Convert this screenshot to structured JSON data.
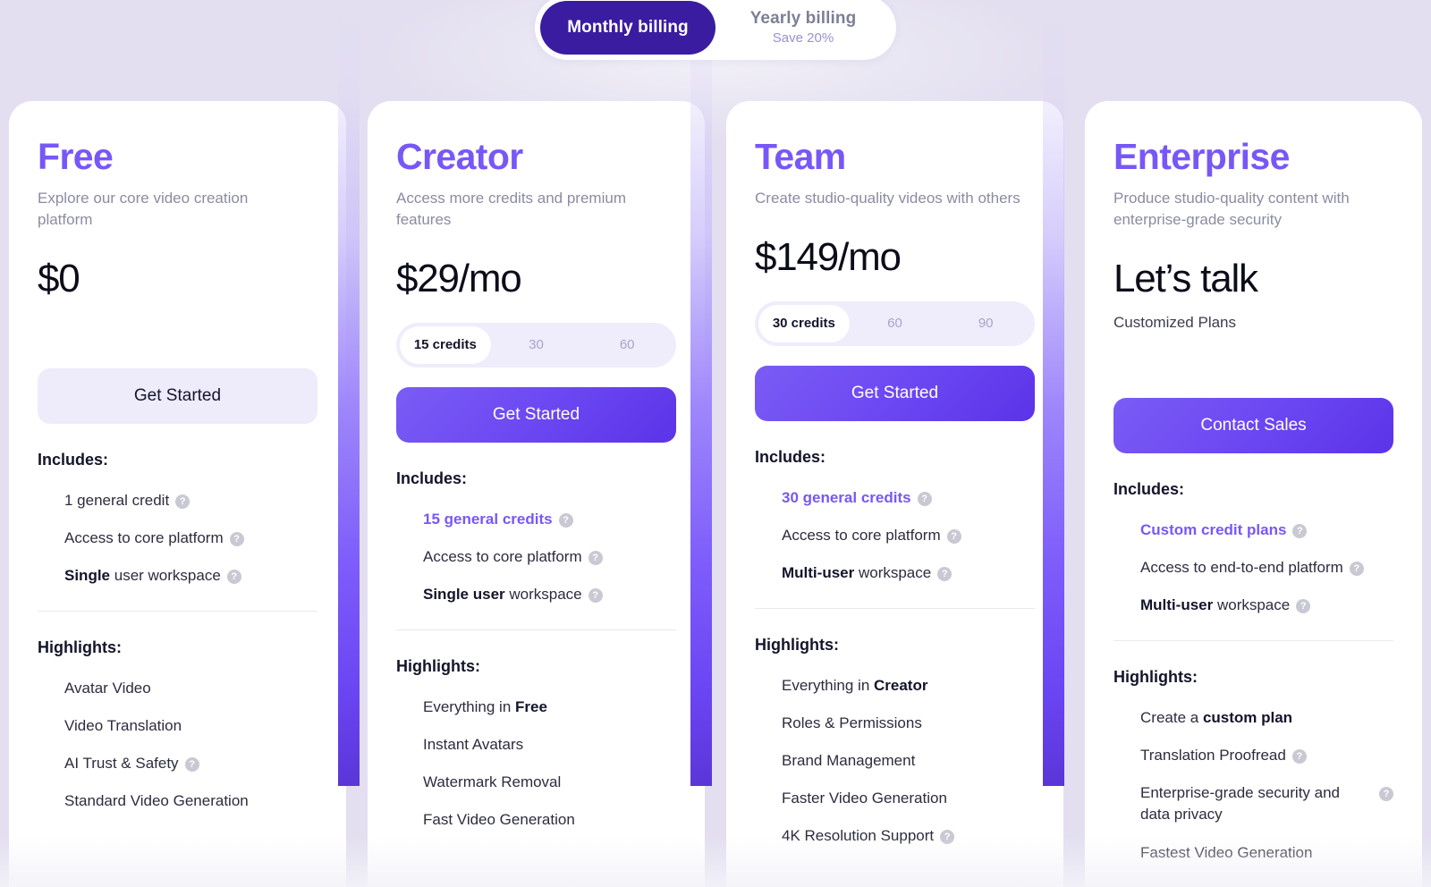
{
  "billing": {
    "monthly_label": "Monthly billing",
    "yearly_label": "Yearly billing",
    "yearly_sub": "Save 20%",
    "active": "monthly"
  },
  "colors": {
    "accent": "#7857f7",
    "accent_dark": "#3a1ca0",
    "background": "#e3dff0",
    "card": "#ffffff"
  },
  "labels": {
    "includes": "Includes:",
    "highlights": "Highlights:",
    "help_glyph": "?"
  },
  "plans": [
    {
      "name": "Free",
      "desc": "Explore our core video creation platform",
      "price": "$0",
      "subprice": "",
      "cta": "Get Started",
      "cta_style": "secondary",
      "credits": null,
      "includes": [
        {
          "text": "1 general credit",
          "help": true,
          "accent": false
        },
        {
          "text": "Access to core platform",
          "help": true,
          "accent": false
        },
        {
          "bold_prefix": "Single",
          "text": " user workspace",
          "help": true,
          "accent": false
        }
      ],
      "highlights": [
        {
          "text": "Avatar Video",
          "help": false
        },
        {
          "text": "Video Translation",
          "help": false
        },
        {
          "text": "AI Trust & Safety",
          "help": true
        },
        {
          "text": "Standard Video Generation",
          "help": false
        }
      ]
    },
    {
      "name": "Creator",
      "desc": "Access more credits and premium features",
      "price": "$29/mo",
      "subprice": "",
      "cta": "Get Started",
      "cta_style": "primary",
      "credits": {
        "options": [
          "15 credits",
          "30",
          "60"
        ],
        "active_index": 0
      },
      "includes": [
        {
          "text": "15 general credits",
          "help": true,
          "accent": true
        },
        {
          "text": "Access to core platform",
          "help": true,
          "accent": false
        },
        {
          "bold_prefix": "Single user",
          "text": " workspace",
          "help": true,
          "accent": false
        }
      ],
      "highlights": [
        {
          "text": "Everything in ",
          "bold_suffix": "Free",
          "help": false
        },
        {
          "text": "Instant Avatars",
          "help": false
        },
        {
          "text": "Watermark Removal",
          "help": false
        },
        {
          "text": "Fast Video Generation",
          "help": false
        }
      ]
    },
    {
      "name": "Team",
      "desc": "Create studio-quality videos with others",
      "price": "$149/mo",
      "subprice": "",
      "cta": "Get Started",
      "cta_style": "primary",
      "credits": {
        "options": [
          "30 credits",
          "60",
          "90"
        ],
        "active_index": 0
      },
      "includes": [
        {
          "text": "30 general credits",
          "help": true,
          "accent": true
        },
        {
          "text": "Access to core platform",
          "help": true,
          "accent": false
        },
        {
          "bold_prefix": "Multi-user",
          "text": " workspace",
          "help": true,
          "accent": false
        }
      ],
      "highlights": [
        {
          "text": "Everything in ",
          "bold_suffix": "Creator",
          "help": false
        },
        {
          "text": "Roles & Permissions",
          "help": false
        },
        {
          "text": "Brand Management",
          "help": false
        },
        {
          "text": "Faster Video Generation",
          "help": false
        },
        {
          "text": "4K Resolution Support",
          "help": true
        }
      ]
    },
    {
      "name": "Enterprise",
      "desc": "Produce studio-quality content with enterprise-grade security",
      "price": "Let’s talk",
      "subprice": "Customized Plans",
      "cta": "Contact Sales",
      "cta_style": "primary",
      "credits": null,
      "includes": [
        {
          "text": "Custom credit plans",
          "help": true,
          "accent": true
        },
        {
          "text": "Access to end-to-end platform",
          "help": true,
          "accent": false
        },
        {
          "bold_prefix": "Multi-user",
          "text": " workspace",
          "help": true,
          "accent": false
        }
      ],
      "highlights": [
        {
          "text": "Create a ",
          "bold_suffix": "custom plan",
          "help": false
        },
        {
          "text": "Translation Proofread",
          "help": true
        },
        {
          "text": "Enterprise-grade security and data privacy",
          "help": true
        },
        {
          "text": "Fastest Video Generation",
          "help": false
        }
      ]
    }
  ]
}
